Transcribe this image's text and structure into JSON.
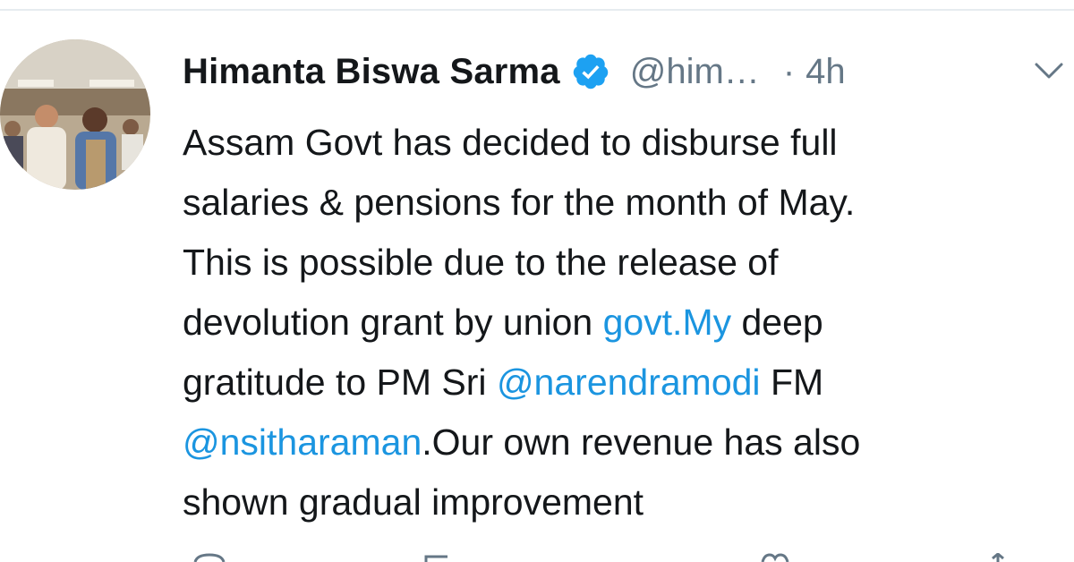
{
  "tweet": {
    "author": {
      "display_name": "Himanta Biswa Sarma",
      "handle": "@him…",
      "verified": true
    },
    "separator": "·",
    "time": "4h",
    "text": {
      "line1": "Assam Govt has decided to disburse full",
      "line2": "salaries & pensions for the month of May.",
      "line3": "This is possible due to the release of",
      "line4_pre": "devolution grant by union ",
      "line4_link": "govt.My",
      "line4_post": " deep",
      "line5_pre": "gratitude to PM Sri ",
      "line5_link": "@narendramodi",
      "line5_post": " FM",
      "line6_link": "@nsitharaman",
      "line6_post": ".Our own revenue has also",
      "line7": "shown gradual improvement"
    }
  },
  "colors": {
    "text": "#14171a",
    "secondary": "#657786",
    "link": "#1b95e0",
    "verified_badge": "#1da1f2"
  },
  "icons": {
    "verified": "verified-badge-icon",
    "menu": "chevron-down-icon",
    "actions": [
      "reply-icon",
      "retweet-icon",
      "like-icon",
      "share-icon"
    ]
  }
}
